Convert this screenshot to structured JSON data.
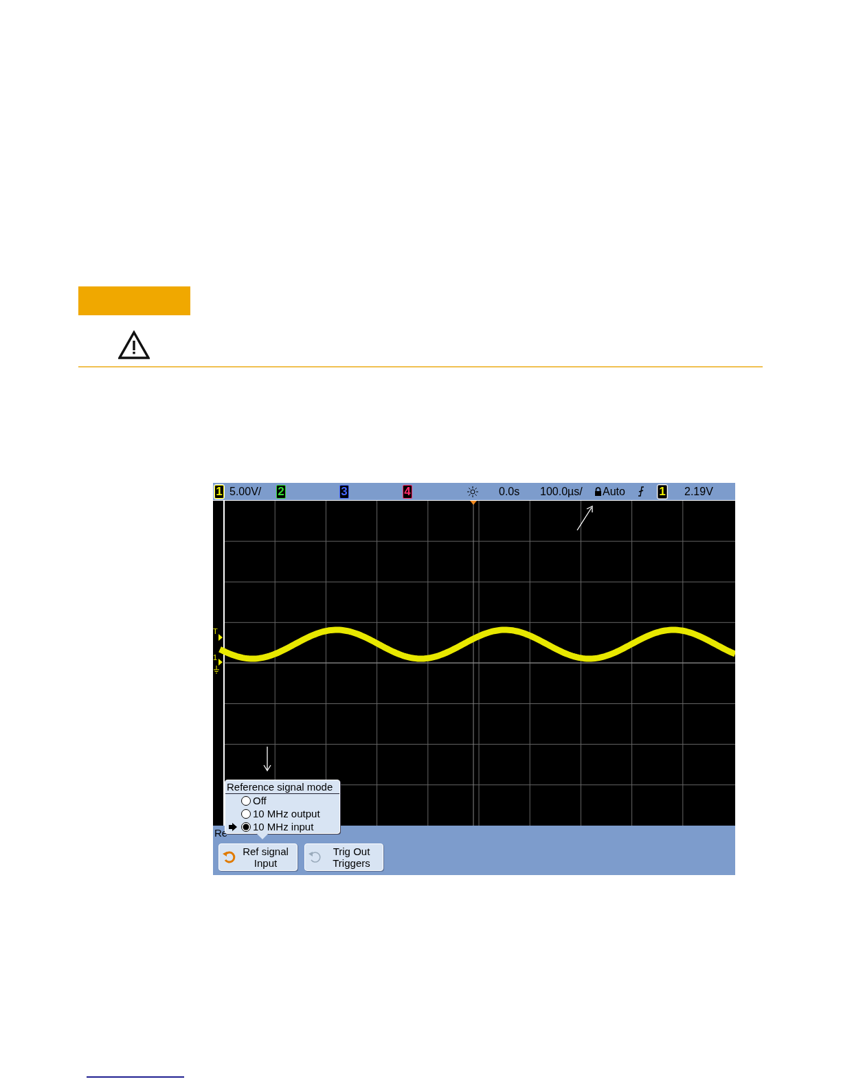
{
  "scope": {
    "top_bar": {
      "channels": [
        {
          "label": "1",
          "color": "#f2f200",
          "selected": true
        },
        {
          "label": "2",
          "color": "#33dd33",
          "selected": false
        },
        {
          "label": "3",
          "color": "#4466ff",
          "selected": false
        },
        {
          "label": "4",
          "color": "#ff2a6a",
          "selected": false
        }
      ],
      "scale": "5.00V/",
      "delay": "0.0s",
      "timebase": "100.0µs/",
      "trigger_mode": "Auto",
      "trigger_source": "1",
      "trigger_level": "2.19V"
    },
    "markers": [
      "T",
      "1"
    ],
    "popup": {
      "title": "Reference signal mode",
      "options": [
        {
          "label": "Off",
          "selected": false
        },
        {
          "label": "10 MHz output",
          "selected": false
        },
        {
          "label": "10 MHz input",
          "selected": true
        }
      ]
    },
    "softkey_menu": {
      "title": "Re",
      "buttons": [
        {
          "lines": [
            "Ref signal",
            "Input"
          ],
          "active": true
        },
        {
          "lines": [
            "Trig Out",
            "Triggers"
          ],
          "active": false
        }
      ]
    }
  }
}
